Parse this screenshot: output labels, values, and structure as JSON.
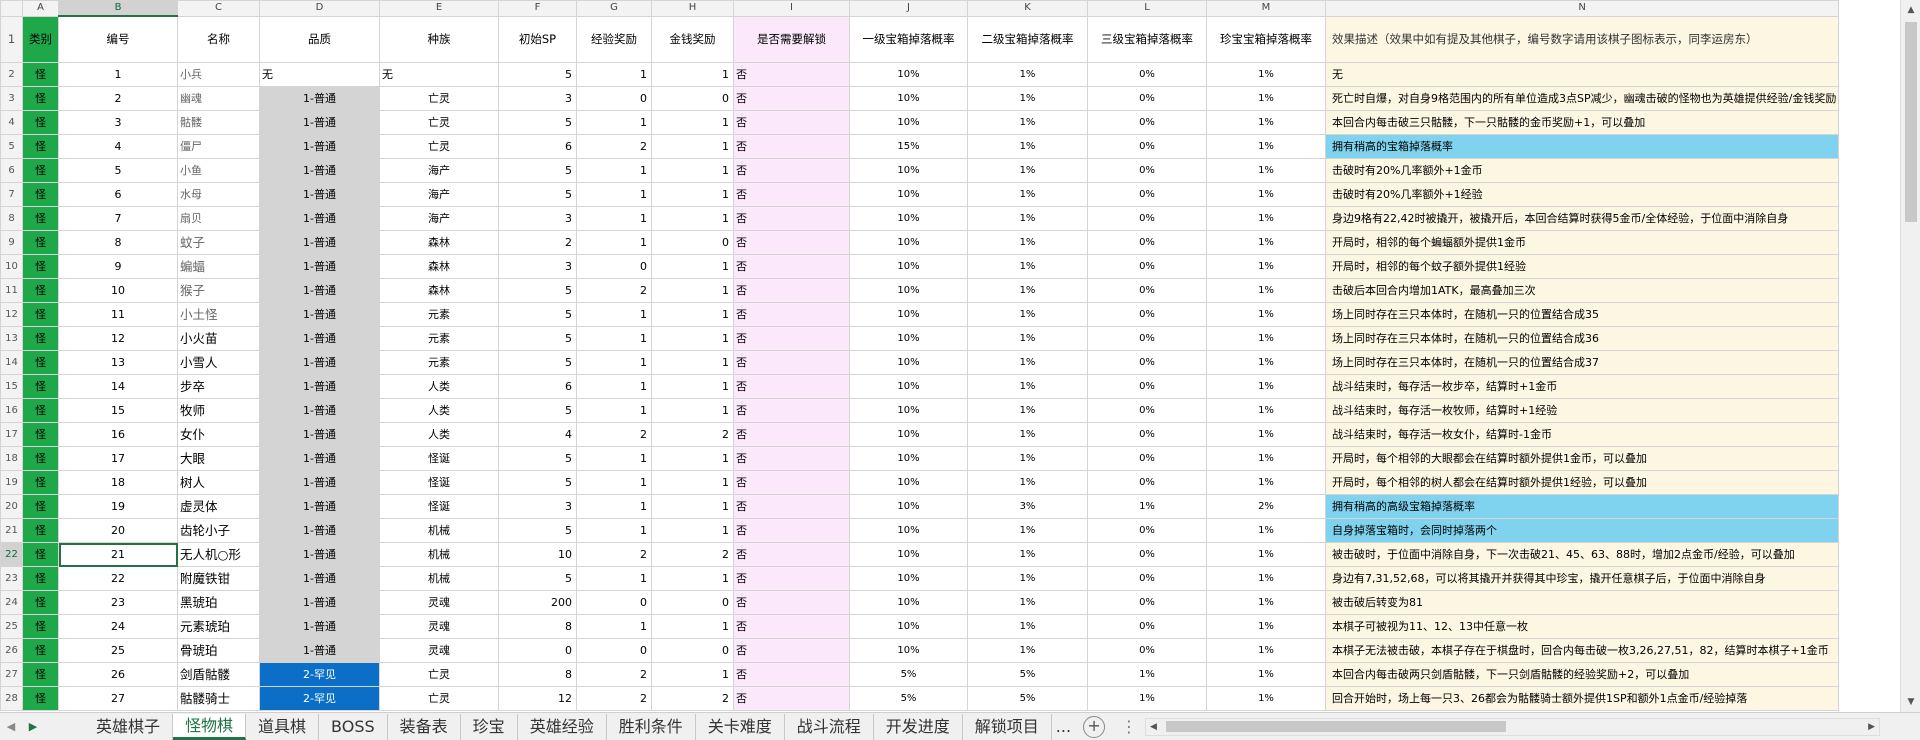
{
  "columns": [
    "A",
    "B",
    "C",
    "D",
    "E",
    "F",
    "G",
    "H",
    "I",
    "J",
    "K",
    "L",
    "M",
    "N"
  ],
  "header_row": {
    "row_num": "1",
    "cells": [
      "类别",
      "编号",
      "名称",
      "品质",
      "种族",
      "初始SP",
      "经验奖励",
      "金钱奖励",
      "是否需要解锁",
      "一级宝箱掉落概率",
      "二级宝箱掉落概率",
      "三级宝箱掉落概率",
      "珍宝宝箱掉落概率",
      "效果描述（效果中如有提及其他棋子，编号数字请用该棋子图标表示，同李运房东）"
    ]
  },
  "rows": [
    {
      "r": "2",
      "a": "怪",
      "b": "1",
      "c": "小兵",
      "d": "无",
      "e": "无",
      "f": "5",
      "g": "1",
      "h": "1",
      "i": "否",
      "j": "10%",
      "k": "1%",
      "l": "0%",
      "m": "1%",
      "n": "无"
    },
    {
      "r": "3",
      "a": "怪",
      "b": "2",
      "c": "幽魂",
      "d": "1-普通",
      "e": "亡灵",
      "f": "3",
      "g": "0",
      "h": "0",
      "i": "否",
      "j": "10%",
      "k": "1%",
      "l": "0%",
      "m": "1%",
      "n": "死亡时自爆，对自身9格范围内的所有单位造成3点SP减少，幽魂击破的怪物也为英雄提供经验/金钱奖励"
    },
    {
      "r": "4",
      "a": "怪",
      "b": "3",
      "c": "骷髅",
      "d": "1-普通",
      "e": "亡灵",
      "f": "5",
      "g": "1",
      "h": "1",
      "i": "否",
      "j": "10%",
      "k": "1%",
      "l": "0%",
      "m": "1%",
      "n": "本回合内每击破三只骷髅，下一只骷髅的金币奖励+1，可以叠加"
    },
    {
      "r": "5",
      "a": "怪",
      "b": "4",
      "c": "僵尸",
      "d": "1-普通",
      "e": "亡灵",
      "f": "6",
      "g": "2",
      "h": "1",
      "i": "否",
      "j": "15%",
      "k": "1%",
      "l": "0%",
      "m": "1%",
      "n": "拥有稍高的宝箱掉落概率"
    },
    {
      "r": "6",
      "a": "怪",
      "b": "5",
      "c": "小鱼",
      "d": "1-普通",
      "e": "海产",
      "f": "5",
      "g": "1",
      "h": "1",
      "i": "否",
      "j": "10%",
      "k": "1%",
      "l": "0%",
      "m": "1%",
      "n": "击破时有20%几率额外+1金币"
    },
    {
      "r": "7",
      "a": "怪",
      "b": "6",
      "c": "水母",
      "d": "1-普通",
      "e": "海产",
      "f": "5",
      "g": "1",
      "h": "1",
      "i": "否",
      "j": "10%",
      "k": "1%",
      "l": "0%",
      "m": "1%",
      "n": "击破时有20%几率额外+1经验"
    },
    {
      "r": "8",
      "a": "怪",
      "b": "7",
      "c": "扇贝",
      "d": "1-普通",
      "e": "海产",
      "f": "3",
      "g": "1",
      "h": "1",
      "i": "否",
      "j": "10%",
      "k": "1%",
      "l": "0%",
      "m": "1%",
      "n": "身边9格有22,42时被撬开，被撬开后，本回合结算时获得5金币/全体经验，于位面中消除自身"
    },
    {
      "r": "9",
      "a": "怪",
      "b": "8",
      "c": "蚊子",
      "d": "1-普通",
      "e": "森林",
      "f": "2",
      "g": "1",
      "h": "0",
      "i": "否",
      "j": "10%",
      "k": "1%",
      "l": "0%",
      "m": "1%",
      "n": "开局时，相邻的每个蝙蝠额外提供1金币"
    },
    {
      "r": "10",
      "a": "怪",
      "b": "9",
      "c": "蝙蝠",
      "d": "1-普通",
      "e": "森林",
      "f": "3",
      "g": "0",
      "h": "1",
      "i": "否",
      "j": "10%",
      "k": "1%",
      "l": "0%",
      "m": "1%",
      "n": "开局时，相邻的每个蚊子额外提供1经验"
    },
    {
      "r": "11",
      "a": "怪",
      "b": "10",
      "c": "猴子",
      "d": "1-普通",
      "e": "森林",
      "f": "5",
      "g": "2",
      "h": "1",
      "i": "否",
      "j": "10%",
      "k": "1%",
      "l": "0%",
      "m": "1%",
      "n": "击破后本回合内增加1ATK，最高叠加三次"
    },
    {
      "r": "12",
      "a": "怪",
      "b": "11",
      "c": "小土怪",
      "d": "1-普通",
      "e": "元素",
      "f": "5",
      "g": "1",
      "h": "1",
      "i": "否",
      "j": "10%",
      "k": "1%",
      "l": "0%",
      "m": "1%",
      "n": "场上同时存在三只本体时，在随机一只的位置结合成35"
    },
    {
      "r": "13",
      "a": "怪",
      "b": "12",
      "c": "小火苗",
      "d": "1-普通",
      "e": "元素",
      "f": "5",
      "g": "1",
      "h": "1",
      "i": "否",
      "j": "10%",
      "k": "1%",
      "l": "0%",
      "m": "1%",
      "n": "场上同时存在三只本体时，在随机一只的位置结合成36"
    },
    {
      "r": "14",
      "a": "怪",
      "b": "13",
      "c": "小雪人",
      "d": "1-普通",
      "e": "元素",
      "f": "5",
      "g": "1",
      "h": "1",
      "i": "否",
      "j": "10%",
      "k": "1%",
      "l": "0%",
      "m": "1%",
      "n": "场上同时存在三只本体时，在随机一只的位置结合成37"
    },
    {
      "r": "15",
      "a": "怪",
      "b": "14",
      "c": "步卒",
      "d": "1-普通",
      "e": "人类",
      "f": "6",
      "g": "1",
      "h": "1",
      "i": "否",
      "j": "10%",
      "k": "1%",
      "l": "0%",
      "m": "1%",
      "n": "战斗结束时，每存活一枚步卒，结算时+1金币"
    },
    {
      "r": "16",
      "a": "怪",
      "b": "15",
      "c": "牧师",
      "d": "1-普通",
      "e": "人类",
      "f": "5",
      "g": "1",
      "h": "1",
      "i": "否",
      "j": "10%",
      "k": "1%",
      "l": "0%",
      "m": "1%",
      "n": "战斗结束时，每存活一枚牧师，结算时+1经验"
    },
    {
      "r": "17",
      "a": "怪",
      "b": "16",
      "c": "女仆",
      "d": "1-普通",
      "e": "人类",
      "f": "4",
      "g": "2",
      "h": "2",
      "i": "否",
      "j": "10%",
      "k": "1%",
      "l": "0%",
      "m": "1%",
      "n": "战斗结束时，每存活一枚女仆，结算时-1金币"
    },
    {
      "r": "18",
      "a": "怪",
      "b": "17",
      "c": "大眼",
      "d": "1-普通",
      "e": "怪诞",
      "f": "5",
      "g": "1",
      "h": "1",
      "i": "否",
      "j": "10%",
      "k": "1%",
      "l": "0%",
      "m": "1%",
      "n": "开局时，每个相邻的大眼都会在结算时额外提供1金币，可以叠加"
    },
    {
      "r": "19",
      "a": "怪",
      "b": "18",
      "c": "树人",
      "d": "1-普通",
      "e": "怪诞",
      "f": "5",
      "g": "1",
      "h": "1",
      "i": "否",
      "j": "10%",
      "k": "1%",
      "l": "0%",
      "m": "1%",
      "n": "开局时，每个相邻的树人都会在结算时额外提供1经验，可以叠加"
    },
    {
      "r": "20",
      "a": "怪",
      "b": "19",
      "c": "虚灵体",
      "d": "1-普通",
      "e": "怪诞",
      "f": "3",
      "g": "1",
      "h": "1",
      "i": "否",
      "j": "10%",
      "k": "3%",
      "l": "1%",
      "m": "2%",
      "n": "拥有稍高的高级宝箱掉落概率"
    },
    {
      "r": "21",
      "a": "怪",
      "b": "20",
      "c": "齿轮小子",
      "d": "1-普通",
      "e": "机械",
      "f": "5",
      "g": "1",
      "h": "1",
      "i": "否",
      "j": "10%",
      "k": "1%",
      "l": "0%",
      "m": "1%",
      "n": "自身掉落宝箱时，会同时掉落两个"
    },
    {
      "r": "22",
      "a": "怪",
      "b": "21",
      "c": "无人机○形",
      "d": "1-普通",
      "e": "机械",
      "f": "10",
      "g": "2",
      "h": "2",
      "i": "否",
      "j": "10%",
      "k": "1%",
      "l": "0%",
      "m": "1%",
      "n": "被击破时，于位面中消除自身，下一次击破21、45、63、88时，增加2点金币/经验，可以叠加"
    },
    {
      "r": "23",
      "a": "怪",
      "b": "22",
      "c": "附魔铁钳",
      "d": "1-普通",
      "e": "机械",
      "f": "5",
      "g": "1",
      "h": "1",
      "i": "否",
      "j": "10%",
      "k": "1%",
      "l": "0%",
      "m": "1%",
      "n": "身边有7,31,52,68，可以将其撬开并获得其中珍宝，撬开任意棋子后，于位面中消除自身"
    },
    {
      "r": "24",
      "a": "怪",
      "b": "23",
      "c": "黑琥珀",
      "d": "1-普通",
      "e": "灵魂",
      "f": "200",
      "g": "0",
      "h": "0",
      "i": "否",
      "j": "10%",
      "k": "1%",
      "l": "0%",
      "m": "1%",
      "n": "被击破后转变为81"
    },
    {
      "r": "25",
      "a": "怪",
      "b": "24",
      "c": "元素琥珀",
      "d": "1-普通",
      "e": "灵魂",
      "f": "8",
      "g": "1",
      "h": "1",
      "i": "否",
      "j": "10%",
      "k": "1%",
      "l": "0%",
      "m": "1%",
      "n": "本棋子可被视为11、12、13中任意一枚"
    },
    {
      "r": "26",
      "a": "怪",
      "b": "25",
      "c": "骨琥珀",
      "d": "1-普通",
      "e": "灵魂",
      "f": "0",
      "g": "0",
      "h": "0",
      "i": "否",
      "j": "10%",
      "k": "1%",
      "l": "0%",
      "m": "1%",
      "n": "本棋子无法被击破，本棋子存在于棋盘时，回合内每击破一枚3,26,27,51，82，结算时本棋子+1金币"
    },
    {
      "r": "27",
      "a": "怪",
      "b": "26",
      "c": "剑盾骷髅",
      "d": "2-罕见",
      "e": "亡灵",
      "f": "8",
      "g": "2",
      "h": "1",
      "i": "否",
      "j": "5%",
      "k": "5%",
      "l": "1%",
      "m": "1%",
      "n": "本回合内每击破两只剑盾骷髅，下一只剑盾骷髅的经验奖励+2，可以叠加"
    },
    {
      "r": "28",
      "a": "怪",
      "b": "27",
      "c": "骷髅骑士",
      "d": "2-罕见",
      "e": "亡灵",
      "f": "12",
      "g": "2",
      "h": "2",
      "i": "否",
      "j": "5%",
      "k": "5%",
      "l": "1%",
      "m": "1%",
      "n": "回合开始时，场上每一只3、26都会为骷髅骑士额外提供1SP和额外1点金币/经验掉落"
    }
  ],
  "sheet_tabs": [
    "英雄棋子",
    "怪物棋",
    "道具棋",
    "BOSS",
    "装备表",
    "珍宝",
    "英雄经验",
    "胜利条件",
    "关卡难度",
    "战斗流程",
    "开发进度",
    "解锁项目"
  ],
  "active_tab": "怪物棋",
  "tab_overflow": "...",
  "selected_cell": "B22",
  "icons": {
    "nav_left": "triangle-left-icon",
    "nav_right": "triangle-right-icon",
    "add_sheet": "plus-circle-icon"
  },
  "colors": {
    "category_green": "#1fa84a",
    "quality_grey": "#d4d4d4",
    "quality_rare_blue": "#0b6fc8",
    "unlock_pink": "#fbe9fb",
    "desc_cream": "#fdf6e3",
    "desc_highlight": "#80d3ee",
    "excel_green": "#217346"
  }
}
